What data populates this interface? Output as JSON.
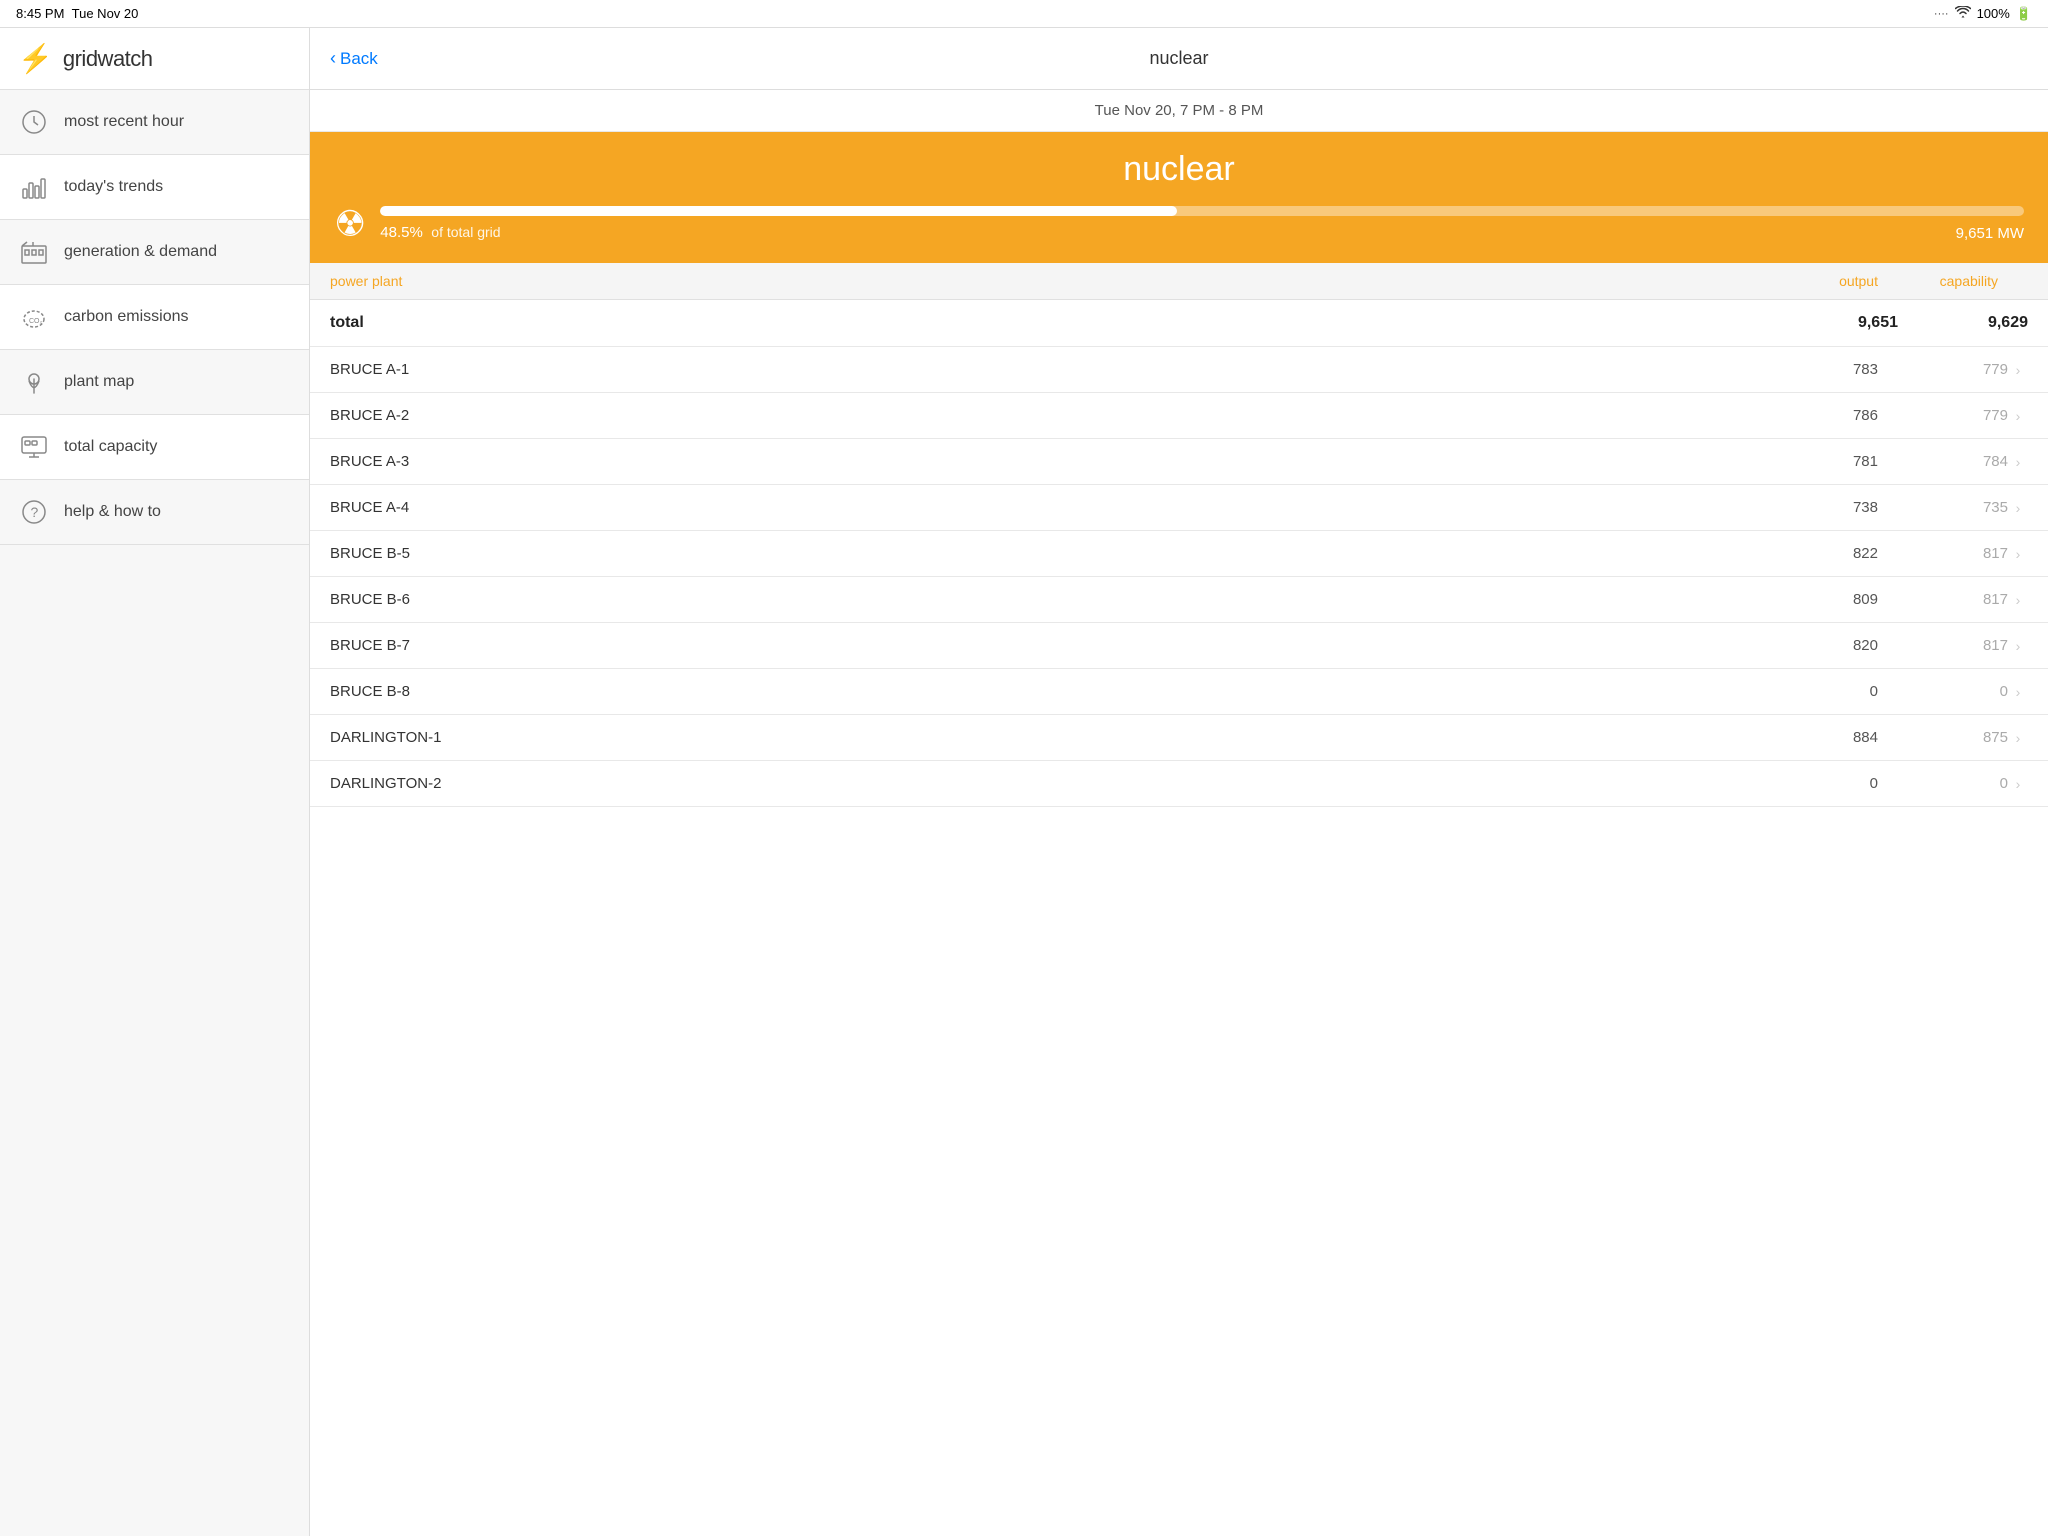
{
  "statusBar": {
    "time": "8:45 PM",
    "date": "Tue Nov 20",
    "battery": "100%"
  },
  "sidebar": {
    "logoText": "gridwatch",
    "items": [
      {
        "id": "most-recent-hour",
        "label": "most recent hour",
        "icon": "clock"
      },
      {
        "id": "todays-trends",
        "label": "today's trends",
        "icon": "chart"
      },
      {
        "id": "generation-demand",
        "label": "generation & demand",
        "icon": "factory"
      },
      {
        "id": "carbon-emissions",
        "label": "carbon emissions",
        "icon": "co2"
      },
      {
        "id": "plant-map",
        "label": "plant map",
        "icon": "map"
      },
      {
        "id": "total-capacity",
        "label": "total capacity",
        "icon": "screen"
      },
      {
        "id": "help-how-to",
        "label": "help & how to",
        "icon": "help"
      }
    ]
  },
  "topNav": {
    "backLabel": "Back",
    "pageTitle": "nuclear"
  },
  "dateBar": {
    "text": "Tue Nov 20, 7 PM - 8 PM"
  },
  "banner": {
    "title": "nuclear",
    "percent": "48.5%",
    "ofTotalGrid": "of total grid",
    "mw": "9,651 MW",
    "progressPercent": 48.5
  },
  "tableHeader": {
    "plant": "power plant",
    "output": "output",
    "capability": "capability"
  },
  "rows": [
    {
      "plant": "total",
      "output": "9,651",
      "capability": "9,629",
      "isTotal": true
    },
    {
      "plant": "BRUCE A-1",
      "output": "783",
      "capability": "779",
      "isTotal": false
    },
    {
      "plant": "BRUCE A-2",
      "output": "786",
      "capability": "779",
      "isTotal": false
    },
    {
      "plant": "BRUCE A-3",
      "output": "781",
      "capability": "784",
      "isTotal": false
    },
    {
      "plant": "BRUCE A-4",
      "output": "738",
      "capability": "735",
      "isTotal": false
    },
    {
      "plant": "BRUCE B-5",
      "output": "822",
      "capability": "817",
      "isTotal": false
    },
    {
      "plant": "BRUCE B-6",
      "output": "809",
      "capability": "817",
      "isTotal": false
    },
    {
      "plant": "BRUCE B-7",
      "output": "820",
      "capability": "817",
      "isTotal": false
    },
    {
      "plant": "BRUCE B-8",
      "output": "0",
      "capability": "0",
      "isTotal": false
    },
    {
      "plant": "DARLINGTON-1",
      "output": "884",
      "capability": "875",
      "isTotal": false
    },
    {
      "plant": "DARLINGTON-2",
      "output": "0",
      "capability": "0",
      "isTotal": false
    }
  ],
  "colors": {
    "orange": "#F5A623",
    "blue": "#007AFF"
  }
}
